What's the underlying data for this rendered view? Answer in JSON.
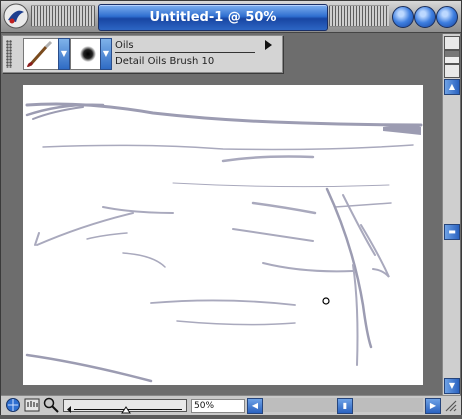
{
  "window": {
    "title": "Untitled-1 @ 50%"
  },
  "property_bar": {
    "brush_category": "Oils",
    "brush_variant": "Detail Oils Brush 10",
    "icons": [
      "brush-category-icon",
      "brush-variant-icon",
      "dropdown-arrow-icon",
      "flyout-menu-arrow-icon"
    ]
  },
  "status_bar": {
    "zoom_label": "50%",
    "zoom_fraction": 0.5
  },
  "colors": {
    "title_bar_accent": "#2f6fd0",
    "window_button": "#3f7fe0",
    "canvas": "#ffffff",
    "sketch_stroke": "#a9a9bd"
  }
}
